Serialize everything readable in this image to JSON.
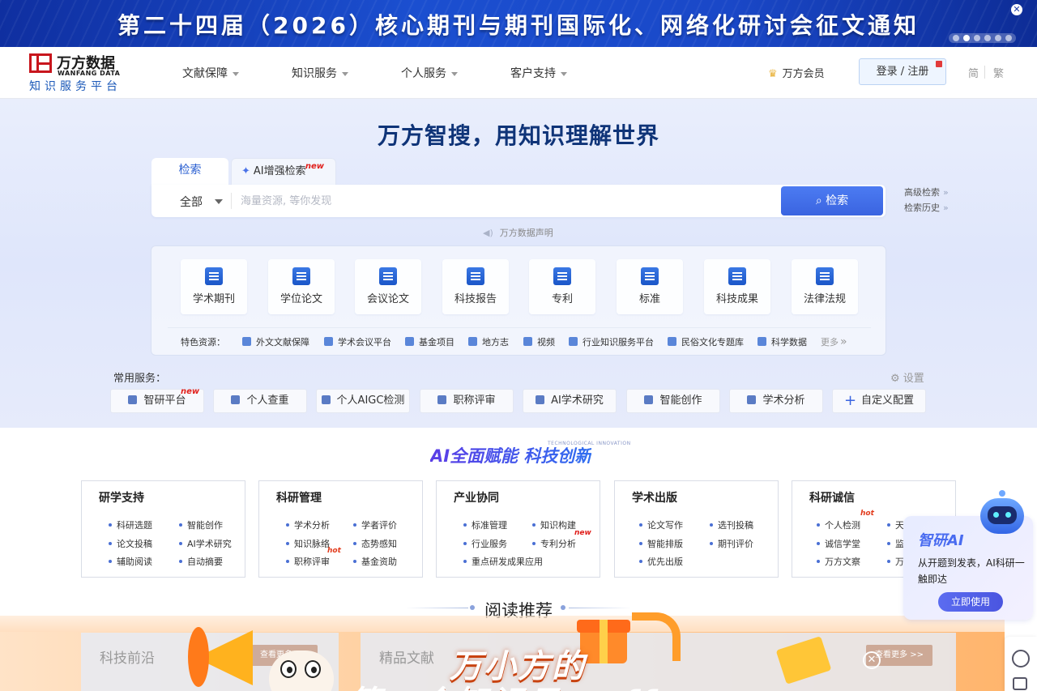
{
  "banner": {
    "title": "第二十四届（2026）核心期刊与期刊国际化、网络化研讨会征文通知",
    "close": "✕",
    "dots": 6,
    "active_dot": 1
  },
  "header": {
    "logo_cn": "万方数据",
    "logo_en": "WANFANG DATA",
    "logo_sub": "知识服务平台",
    "nav": [
      "文献保障",
      "知识服务",
      "个人服务",
      "客户支持"
    ],
    "vip": "万方会员",
    "login": "登录 / 注册",
    "lang_simplified": "简",
    "lang_traditional": "繁"
  },
  "hero": {
    "slogan": "万方智搜，用知识理解世界",
    "tab_search": "检索",
    "tab_ai": "AI增强检索",
    "tab_ai_badge": "new",
    "scope": "全部",
    "search_placeholder": "海量资源, 等你发现",
    "search_button": "检索",
    "advanced": "高级检索",
    "history": "检索历史",
    "statement": "万方数据声明"
  },
  "resources": [
    "学术期刊",
    "学位论文",
    "会议论文",
    "科技报告",
    "专利",
    "标准",
    "科技成果",
    "法律法规"
  ],
  "featured": {
    "label": "特色资源：",
    "items": [
      "外文文献保障",
      "学术会议平台",
      "基金项目",
      "地方志",
      "视频",
      "行业知识服务平台",
      "民俗文化专题库",
      "科学数据"
    ],
    "more": "更多"
  },
  "services": {
    "label": "常用服务：",
    "settings": "设置",
    "items": [
      "智研平台",
      "个人查重",
      "个人AIGC检测",
      "职称评审",
      "AI学术研究",
      "智能创作",
      "学术分析",
      "自定义配置"
    ],
    "badge": "new"
  },
  "ai_section": {
    "title": "AI全面赋能 科技创新",
    "subtitle": "TECHNOLOGICAL INNOVATION",
    "cards": [
      {
        "title": "研学支持",
        "items": [
          "科研选题",
          "智能创作",
          "论文投稿",
          "AI学术研究",
          "辅助阅读",
          "自动摘要"
        ]
      },
      {
        "title": "科研管理",
        "items": [
          "学术分析",
          "学者评价",
          "知识脉络",
          "态势感知",
          "职称评审",
          "基金资助"
        ]
      },
      {
        "title": "产业协同",
        "items": [
          "标准管理",
          "知识构建",
          "行业服务",
          "专利分析",
          "重点研发成果应用"
        ]
      },
      {
        "title": "学术出版",
        "items": [
          "论文写作",
          "选刊投稿",
          "智能排版",
          "期刊评价",
          "优先出版"
        ]
      },
      {
        "title": "科研诚信",
        "items": [
          "个人检测",
          "天",
          "诚信学堂",
          "监",
          "万方文察",
          "万"
        ]
      }
    ],
    "hot": "hot",
    "new": "new"
  },
  "reading": {
    "title": "阅读推荐",
    "tile1": "科技前沿",
    "tile2": "精品文献",
    "more": "查看更多 >>"
  },
  "ai_float": {
    "title": "智研AI",
    "desc": "从开题到发表，AI科研一触即达",
    "button": "立即使用"
  },
  "promo": {
    "title": "万小方的",
    "subtitle": "第一个知识日 ...ff",
    "close": "✕"
  }
}
